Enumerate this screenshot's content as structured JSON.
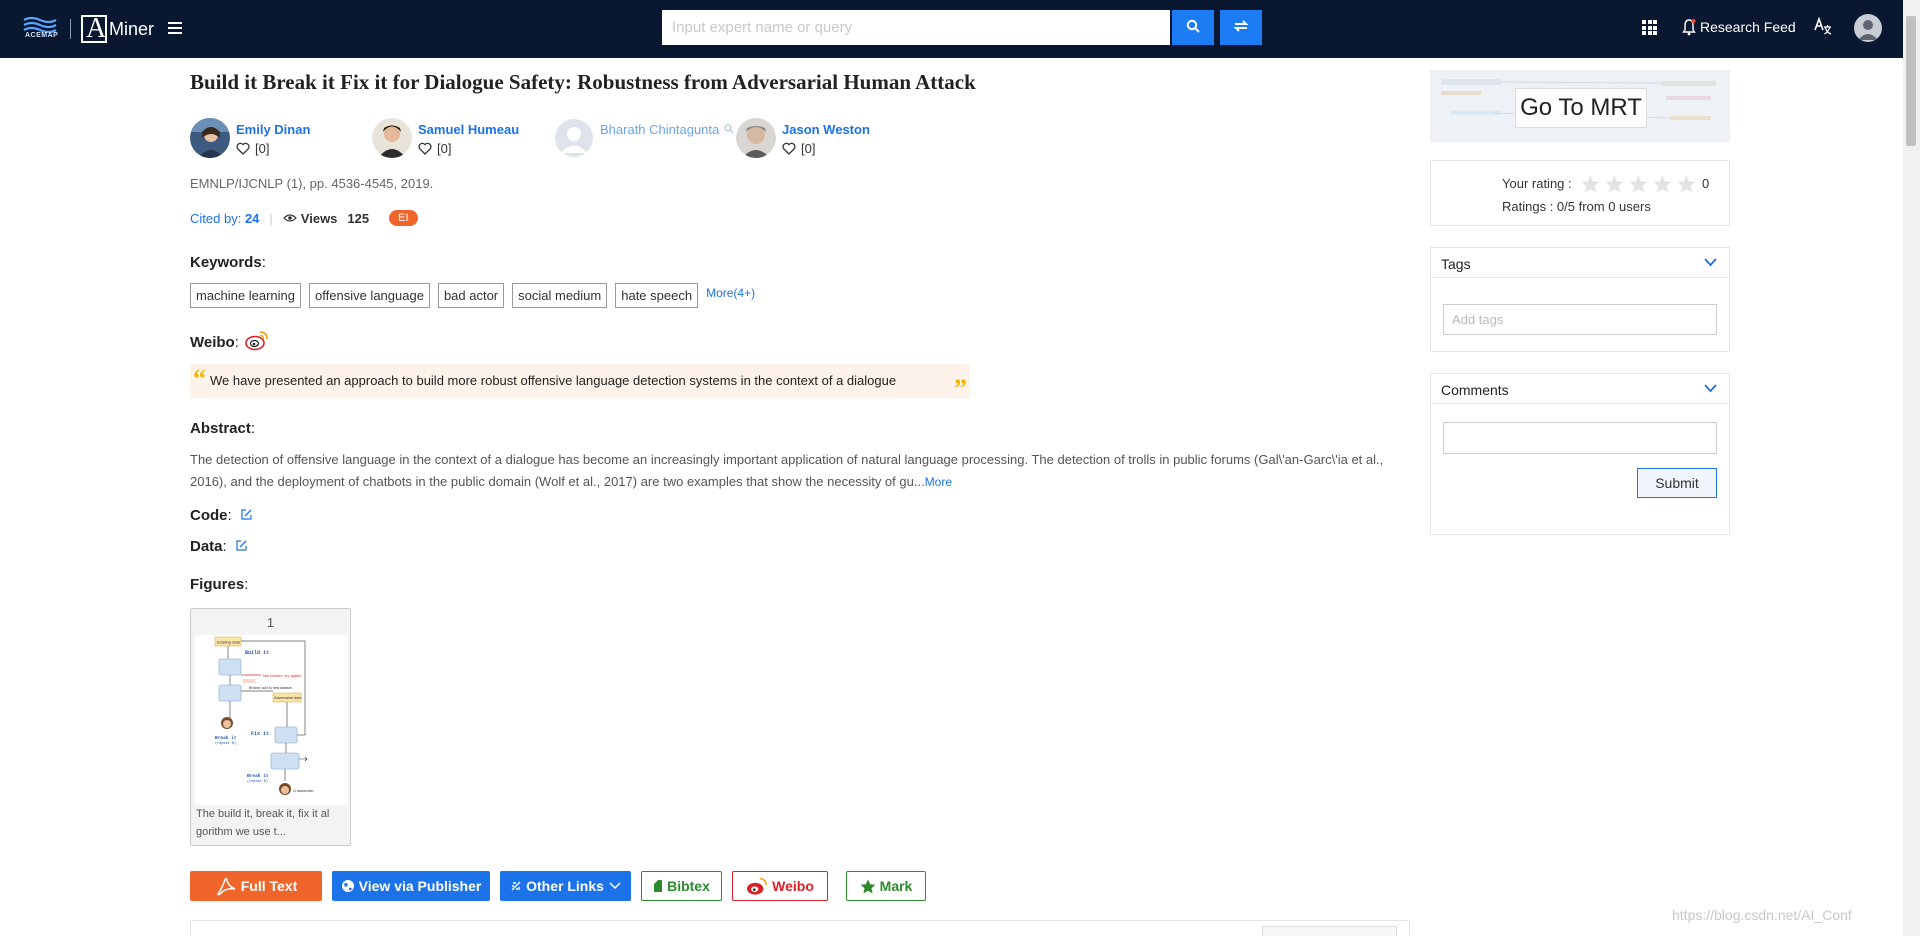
{
  "header": {
    "acemap_logo_text": "ACEMAP",
    "aminer_logo_text": "Miner",
    "search": {
      "placeholder": "Input expert name or query",
      "value": ""
    },
    "research_feed_label": "Research Feed",
    "icons": [
      "acemap-logo",
      "aminer-logo",
      "menu-icon",
      "search-icon",
      "swap-icon",
      "apps-grid-icon",
      "bell-icon",
      "language-icon",
      "user-avatar-icon"
    ]
  },
  "paper": {
    "title": "Build it Break it Fix it for Dialogue Safety: Robustness from Adversarial Human Attack",
    "authors": [
      {
        "name": "Emily Dinan",
        "follow_count": "[0]"
      },
      {
        "name": "Samuel Humeau",
        "follow_count": "[0]"
      },
      {
        "name": "Bharath Chintagunta",
        "follow_count": ""
      },
      {
        "name": "Jason Weston",
        "follow_count": "[0]"
      }
    ],
    "venue": "EMNLP/IJCNLP (1), pp. 4536-4545, 2019.",
    "cited_by_label": "Cited by:",
    "cited_by_count": "24",
    "views_label": "Views",
    "views_count": "125",
    "badge": "EI",
    "keywords_label": "Keywords",
    "keywords": [
      "machine learning",
      "offensive language",
      "bad actor",
      "social medium",
      "hate speech"
    ],
    "keywords_more": "More(4+)",
    "weibo_label": "Weibo",
    "weibo_quote": "We have presented an approach to build more robust offensive language detection systems in the context of a dialogue",
    "abstract_label": "Abstract",
    "abstract_text": "The detection of offensive language in the context of a dialogue has become an increasingly important application of natural language processing. The detection of trolls in public forums (Gal\\'an-Garc\\'ia et al., 2016), and the deployment of chatbots in the public domain (Wolf et al., 2017) are two examples that show the necessity of gu...",
    "abstract_more": "More",
    "code_label": "Code",
    "data_label": "Data",
    "figures_label": "Figures",
    "figure": {
      "number": "1",
      "caption": "The build it, break it, fix it al gorithm we use t...",
      "diagram_text": {
        "box_top": "Existing data",
        "build": "Build it",
        "crowdworker": "Crowdworker",
        "not_broken": "Not broken: try again!",
        "broken": "Broken: add to new dataset",
        "adversarial": "Adversarial data",
        "fix": "Fix it",
        "break": "Break it",
        "training": "Training",
        "offensive": "Offensive message",
        "repeat": "(repeat N)"
      }
    },
    "buttons": {
      "full_text": "Full Text",
      "publisher": "View via Publisher",
      "other_links": "Other Links",
      "bibtex": "Bibtex",
      "weibo": "Weibo",
      "mark": "Mark"
    }
  },
  "sidebar": {
    "mrt_label": "Go To MRT",
    "rating": {
      "your_rating_label": "Your rating :",
      "star_count": 5,
      "filled_stars": 0,
      "value": "0",
      "summary": "Ratings : 0/5 from 0 users"
    },
    "tags": {
      "title": "Tags",
      "placeholder": "Add tags"
    },
    "comments": {
      "title": "Comments",
      "value": "",
      "submit_label": "Submit"
    }
  },
  "watermark": "https://blog.csdn.net/AI_Conf",
  "colors": {
    "topbar": "#0a1730",
    "link_blue": "#1c72e8",
    "orange": "#f0662a",
    "green": "#2e8b2e",
    "weibo_red": "#d9232a",
    "quote_bg": "#fdf3ea"
  }
}
